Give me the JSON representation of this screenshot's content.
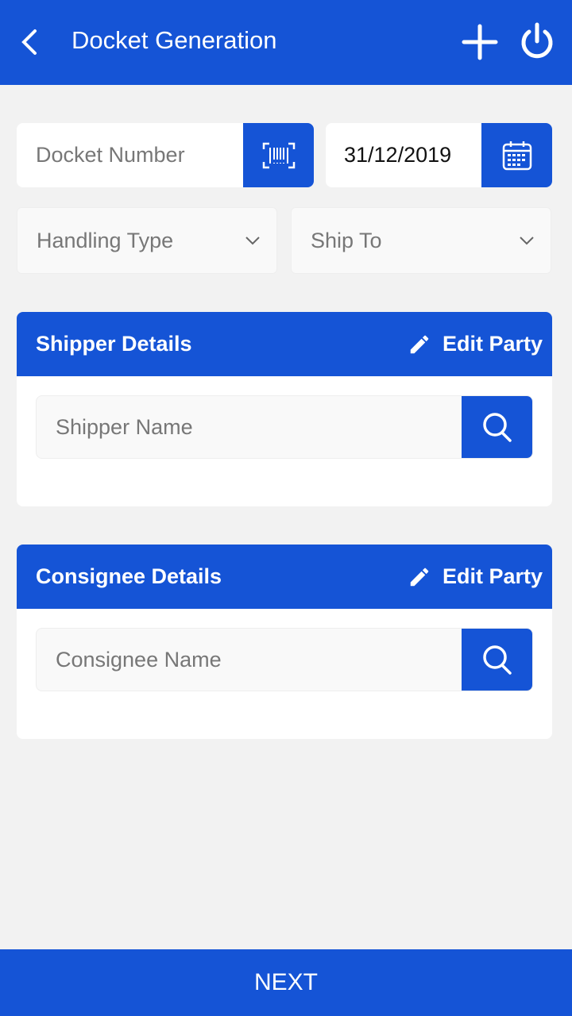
{
  "header": {
    "title": "Docket Generation",
    "back_icon": "chevron-left-icon",
    "add_icon": "plus-icon",
    "power_icon": "power-icon"
  },
  "docket": {
    "placeholder": "Docket Number",
    "scan_icon": "barcode-icon"
  },
  "date": {
    "value": "31/12/2019",
    "calendar_icon": "calendar-icon"
  },
  "handling_type": {
    "placeholder": "Handling Type"
  },
  "ship_to": {
    "placeholder": "Ship To"
  },
  "shipper": {
    "title": "Shipper Details",
    "edit_label": "Edit Party",
    "placeholder": "Shipper Name"
  },
  "consignee": {
    "title": "Consignee Details",
    "edit_label": "Edit Party",
    "placeholder": "Consignee Name"
  },
  "footer": {
    "next_label": "NEXT"
  },
  "colors": {
    "primary": "#1554d6",
    "background": "#f2f2f2"
  }
}
